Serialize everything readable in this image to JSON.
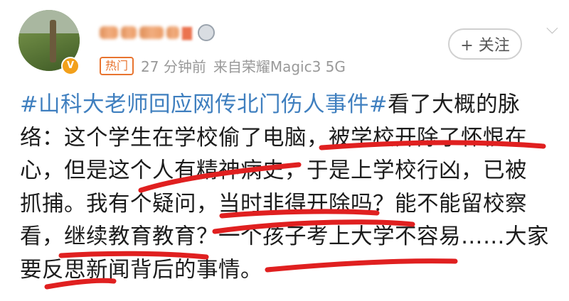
{
  "user": {
    "name_obscured": "▇",
    "vip_badge": "V"
  },
  "meta": {
    "hot_tag": "热门",
    "time": "27 分钟前",
    "source": "来自荣耀Magic3 5G"
  },
  "follow_button": "+ 关注",
  "menu_icon": "chevron-down",
  "post": {
    "topic": "#山科大老师回应网传北门伤人事件#",
    "lines": [
      "看了大概的脉",
      "络：这个学生在学校偷了电脑，被学校开除了怀恨在",
      "心，但是这个人有精神病史，于是上学校行凶，已被",
      "抓捕。我有个疑问，当时非得开除吗？能不能留校察",
      "看，继续教育教育？一个孩子考上大学不容易……大家",
      "要反思新闻背后的事情。"
    ]
  },
  "annotation_color": "#e02020"
}
